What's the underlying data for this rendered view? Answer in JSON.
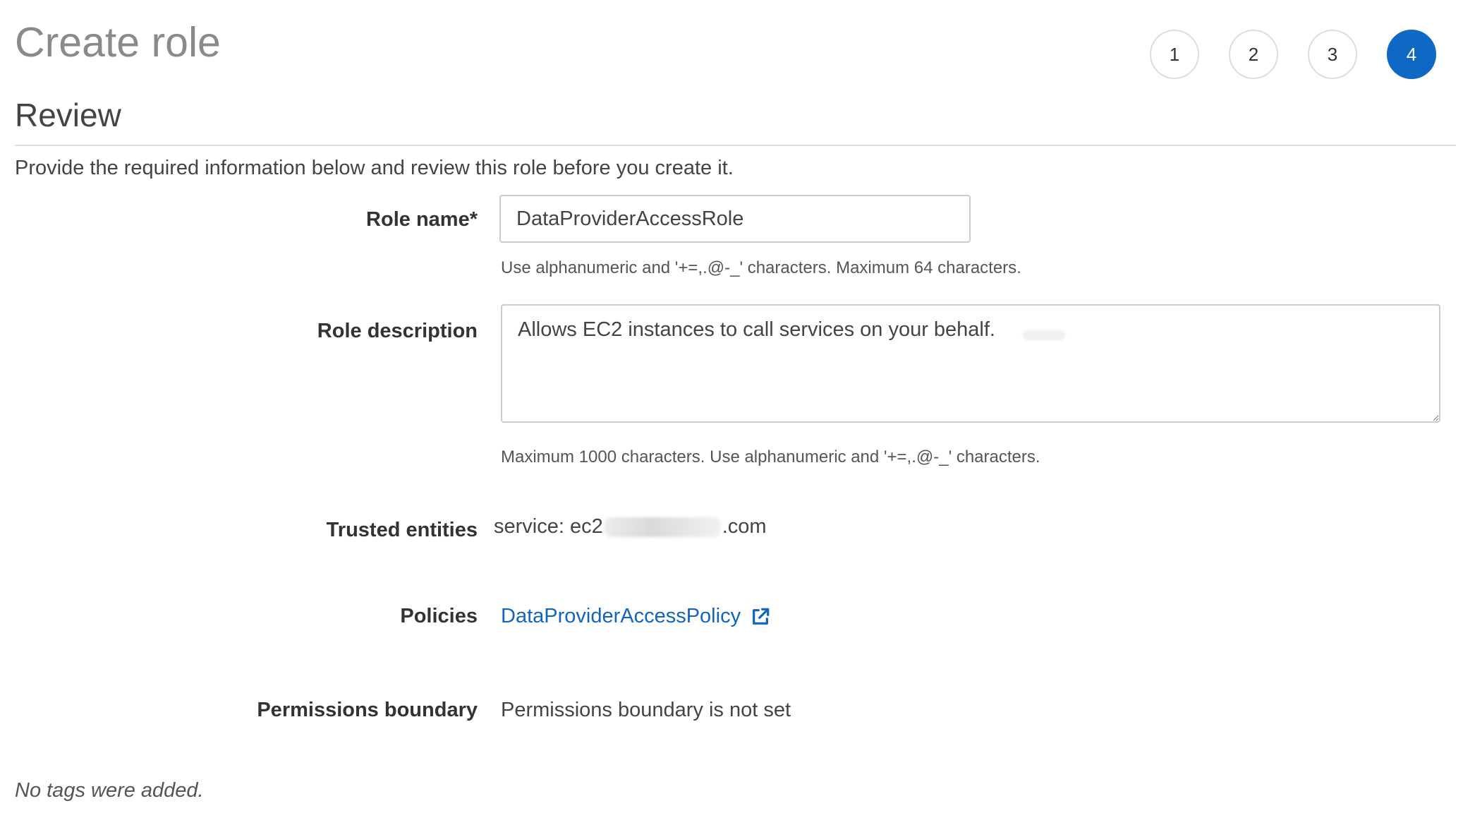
{
  "header": {
    "title": "Create role"
  },
  "steps": [
    "1",
    "2",
    "3",
    "4"
  ],
  "active_step": "4",
  "section": {
    "title": "Review",
    "intro": "Provide the required information below and review this role before you create it."
  },
  "form": {
    "role_name": {
      "label": "Role name*",
      "value": "DataProviderAccessRole",
      "hint": "Use alphanumeric and '+=,.@-_' characters. Maximum 64 characters."
    },
    "role_description": {
      "label": "Role description",
      "value": "Allows EC2 instances to call services on your behalf.",
      "hint": "Maximum 1000 characters. Use alphanumeric and '+=,.@-_' characters."
    },
    "trusted_entities": {
      "label": "Trusted entities",
      "prefix": "service: ec2",
      "suffix": ".com"
    },
    "policies": {
      "label": "Policies",
      "link": "DataProviderAccessPolicy",
      "icon": "external-link-icon"
    },
    "permissions_boundary": {
      "label": "Permissions boundary",
      "value": "Permissions boundary is not set"
    }
  },
  "tags": {
    "note": "No tags were added."
  },
  "colors": {
    "accent": "#0f68c4",
    "link": "#1166bb"
  }
}
